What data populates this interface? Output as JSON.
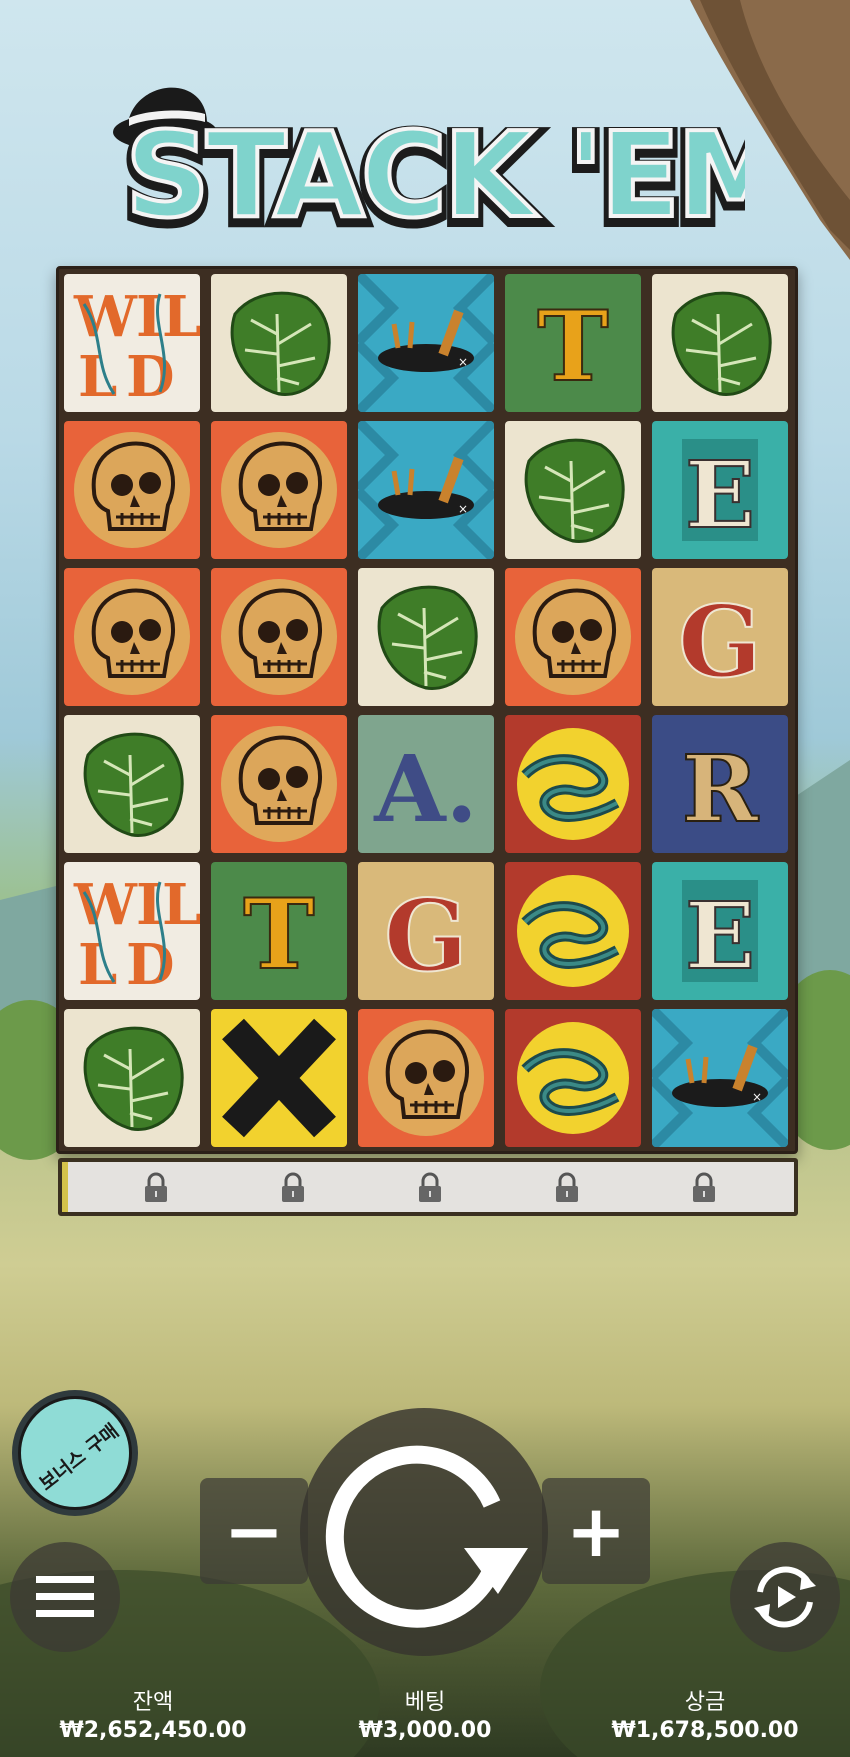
{
  "game": {
    "title_word1": "STACK",
    "title_word2": "'EM"
  },
  "reels": {
    "rows": [
      [
        "wild",
        "leaf",
        "bird",
        "letter-T",
        "leaf"
      ],
      [
        "skull",
        "skull",
        "bird",
        "leaf",
        "letter-E"
      ],
      [
        "skull",
        "skull",
        "leaf",
        "skull",
        "letter-G"
      ],
      [
        "leaf",
        "skull",
        "letter-A",
        "snake",
        "letter-R"
      ],
      [
        "wild",
        "letter-T",
        "letter-G",
        "snake",
        "letter-E"
      ],
      [
        "leaf",
        "letter-X",
        "skull",
        "snake",
        "bird"
      ]
    ],
    "locked_count": 5
  },
  "controls": {
    "bonus_buy_label": "보너스 구매",
    "minus_label": "−",
    "plus_label": "+",
    "spin_icon": "spin-arrow-icon",
    "menu_icon": "hamburger-menu-icon",
    "autoplay_icon": "autoplay-icon"
  },
  "footer": {
    "balance_label": "잔액",
    "balance_value": "₩2,652,450.00",
    "bet_label": "베팅",
    "bet_value": "₩3,000.00",
    "win_label": "상금",
    "win_value": "₩1,678,500.00"
  },
  "colors": {
    "logo_teal": "#7fd3cc",
    "leaf_green": "#3f7d28",
    "skull_bg": "#e8633a",
    "bird_bg": "#3aa9c4",
    "snake_bg": "#b33a2c",
    "cream": "#efe6d2"
  }
}
